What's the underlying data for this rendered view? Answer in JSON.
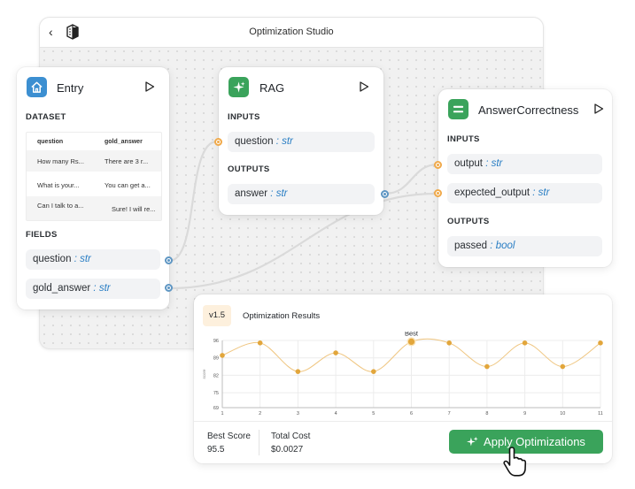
{
  "window": {
    "title": "Optimization Studio"
  },
  "entry": {
    "title": "Entry",
    "dataset_label": "DATASET",
    "dataset": {
      "headers": [
        "question",
        "gold_answer"
      ],
      "rows": [
        [
          "How many Rs...",
          "There are 3 r..."
        ],
        [
          "What is your...",
          "You can get a..."
        ],
        [
          "Can I talk to a...",
          "Sure! I will re..."
        ]
      ]
    },
    "fields_label": "FIELDS",
    "fields": [
      {
        "name": "question",
        "sep": ":",
        "type": "str"
      },
      {
        "name": "gold_answer",
        "sep": ":",
        "type": "str"
      }
    ]
  },
  "rag": {
    "title": "RAG",
    "inputs_label": "INPUTS",
    "input": {
      "name": "question",
      "sep": ":",
      "type": "str"
    },
    "outputs_label": "OUTPUTS",
    "output": {
      "name": "answer",
      "sep": ":",
      "type": "str"
    }
  },
  "answer_correctness": {
    "title": "AnswerCorrectness",
    "inputs_label": "INPUTS",
    "inputs": [
      {
        "name": "output",
        "sep": ":",
        "type": "str"
      },
      {
        "name": "expected_output",
        "sep": ":",
        "type": "str"
      }
    ],
    "outputs_label": "OUTPUTS",
    "output": {
      "name": "passed",
      "sep": ":",
      "type": "bool"
    }
  },
  "results": {
    "version": "v1.5",
    "title": "Optimization Results",
    "best_score_label": "Best Score",
    "best_score": "95.5",
    "total_cost_label": "Total Cost",
    "total_cost": "$0.0027",
    "apply_label": "Apply Optimizations"
  },
  "chart_data": {
    "type": "line",
    "x": [
      1,
      2,
      3,
      4,
      5,
      6,
      7,
      8,
      9,
      10,
      11
    ],
    "values": [
      90,
      95,
      83.5,
      91,
      83.5,
      95.5,
      95,
      85.5,
      95,
      85.5,
      95
    ],
    "ylabel": "score",
    "ylim": [
      69,
      96
    ],
    "yticks": [
      69,
      75,
      82,
      89,
      96
    ],
    "annotation": {
      "label": "Best",
      "x": 6
    },
    "grid": true,
    "color": "#e2a63b"
  },
  "colors": {
    "entry_icon": "#3c8fd1",
    "rag_icon": "#3aa35b",
    "answer_icon": "#3aa35b",
    "accent": "#3aa35b",
    "edge": "#dadada"
  },
  "icons": {
    "back": "chevron-left-icon",
    "logo": "app-logo-icon",
    "entry": "home-icon",
    "rag": "sparkles-icon",
    "answer": "equals-icon",
    "run": "play-icon",
    "apply": "sparkles-icon",
    "cursor": "pointer-cursor-icon"
  }
}
